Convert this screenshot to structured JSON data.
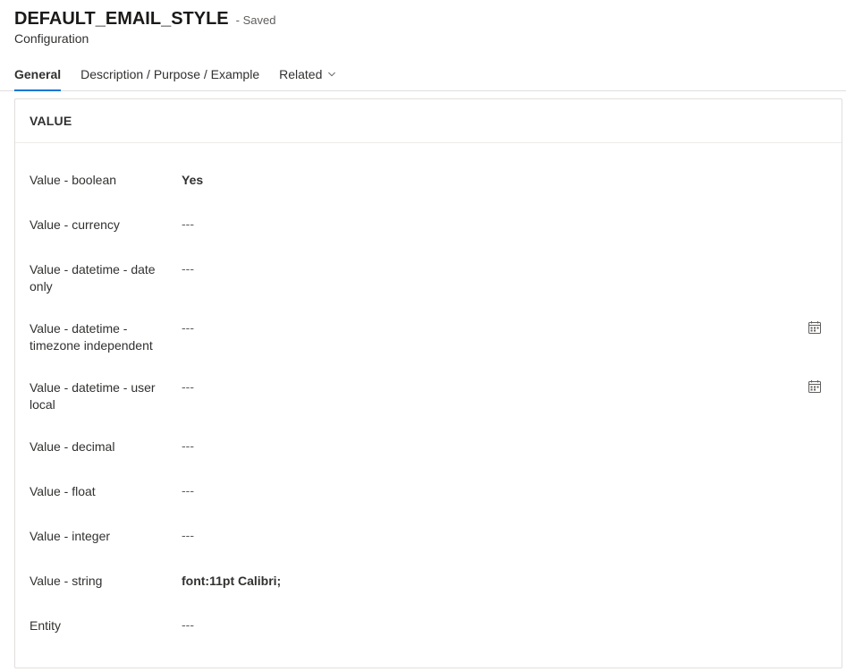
{
  "header": {
    "title": "DEFAULT_EMAIL_STYLE",
    "status": "- Saved",
    "entity": "Configuration"
  },
  "tabs": {
    "items": [
      {
        "label": "General",
        "active": true
      },
      {
        "label": "Description / Purpose / Example",
        "active": false
      },
      {
        "label": "Related",
        "active": false,
        "dropdown": true
      }
    ]
  },
  "section": {
    "title": "VALUE",
    "placeholder": "---",
    "fields": [
      {
        "label": "Value - boolean",
        "value": "Yes",
        "bold": true,
        "calendar": false
      },
      {
        "label": "Value - currency",
        "value": "",
        "bold": false,
        "calendar": false
      },
      {
        "label": "Value - datetime - date only",
        "value": "",
        "bold": false,
        "calendar": false
      },
      {
        "label": "Value - datetime - timezone independent",
        "value": "",
        "bold": false,
        "calendar": true
      },
      {
        "label": "Value - datetime - user local",
        "value": "",
        "bold": false,
        "calendar": true
      },
      {
        "label": "Value - decimal",
        "value": "",
        "bold": false,
        "calendar": false
      },
      {
        "label": "Value - float",
        "value": "",
        "bold": false,
        "calendar": false
      },
      {
        "label": "Value - integer",
        "value": "",
        "bold": false,
        "calendar": false
      },
      {
        "label": "Value - string",
        "value": "font:11pt Calibri;",
        "bold": true,
        "calendar": false
      },
      {
        "label": "Entity",
        "value": "",
        "bold": false,
        "calendar": false
      }
    ]
  }
}
